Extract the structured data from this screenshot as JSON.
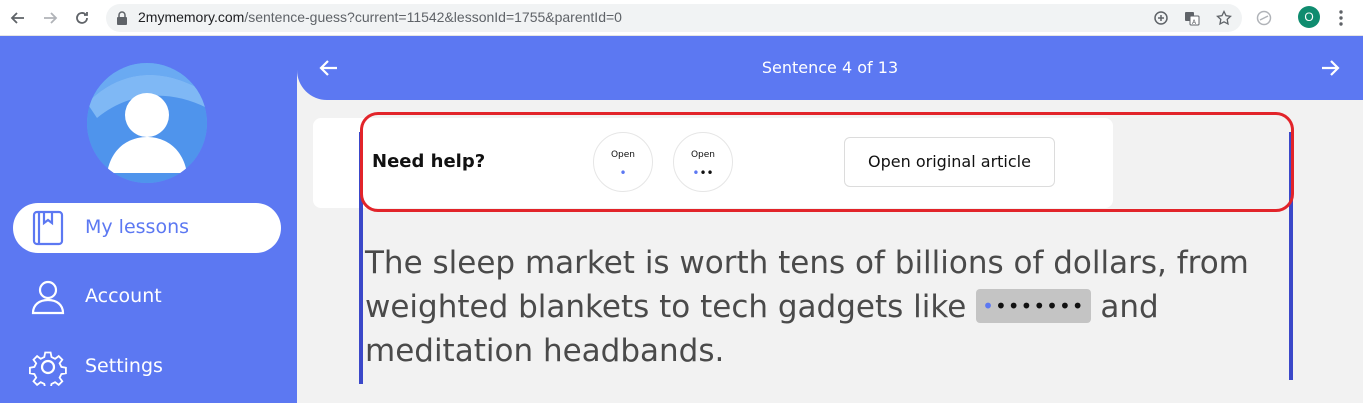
{
  "browser": {
    "url_host": "2mymemory.com",
    "url_path": "/sentence-guess?current=11542&lessonId=1755&parentId=0",
    "profile_initial": "O"
  },
  "sidebar": {
    "items": [
      {
        "label": "My lessons",
        "icon": "book-icon",
        "active": true
      },
      {
        "label": "Account",
        "icon": "user-icon",
        "active": false
      },
      {
        "label": "Settings",
        "icon": "gear-icon",
        "active": false
      }
    ]
  },
  "header": {
    "title": "Sentence 4 of 13"
  },
  "help": {
    "label": "Need help?",
    "hint1_label": "Open",
    "hint2_label": "Open",
    "open_article_label": "Open original article"
  },
  "sentence": {
    "before": "The sleep market is worth tens of billions of dollars, from weighted blankets to tech gadgets like ",
    "blank_revealed": "•",
    "blank_hidden": "•••••••",
    "after": " and meditation headbands."
  },
  "colors": {
    "accent": "#5c78f2",
    "highlight_frame": "#e2242a",
    "side_line": "#3b48c9"
  }
}
